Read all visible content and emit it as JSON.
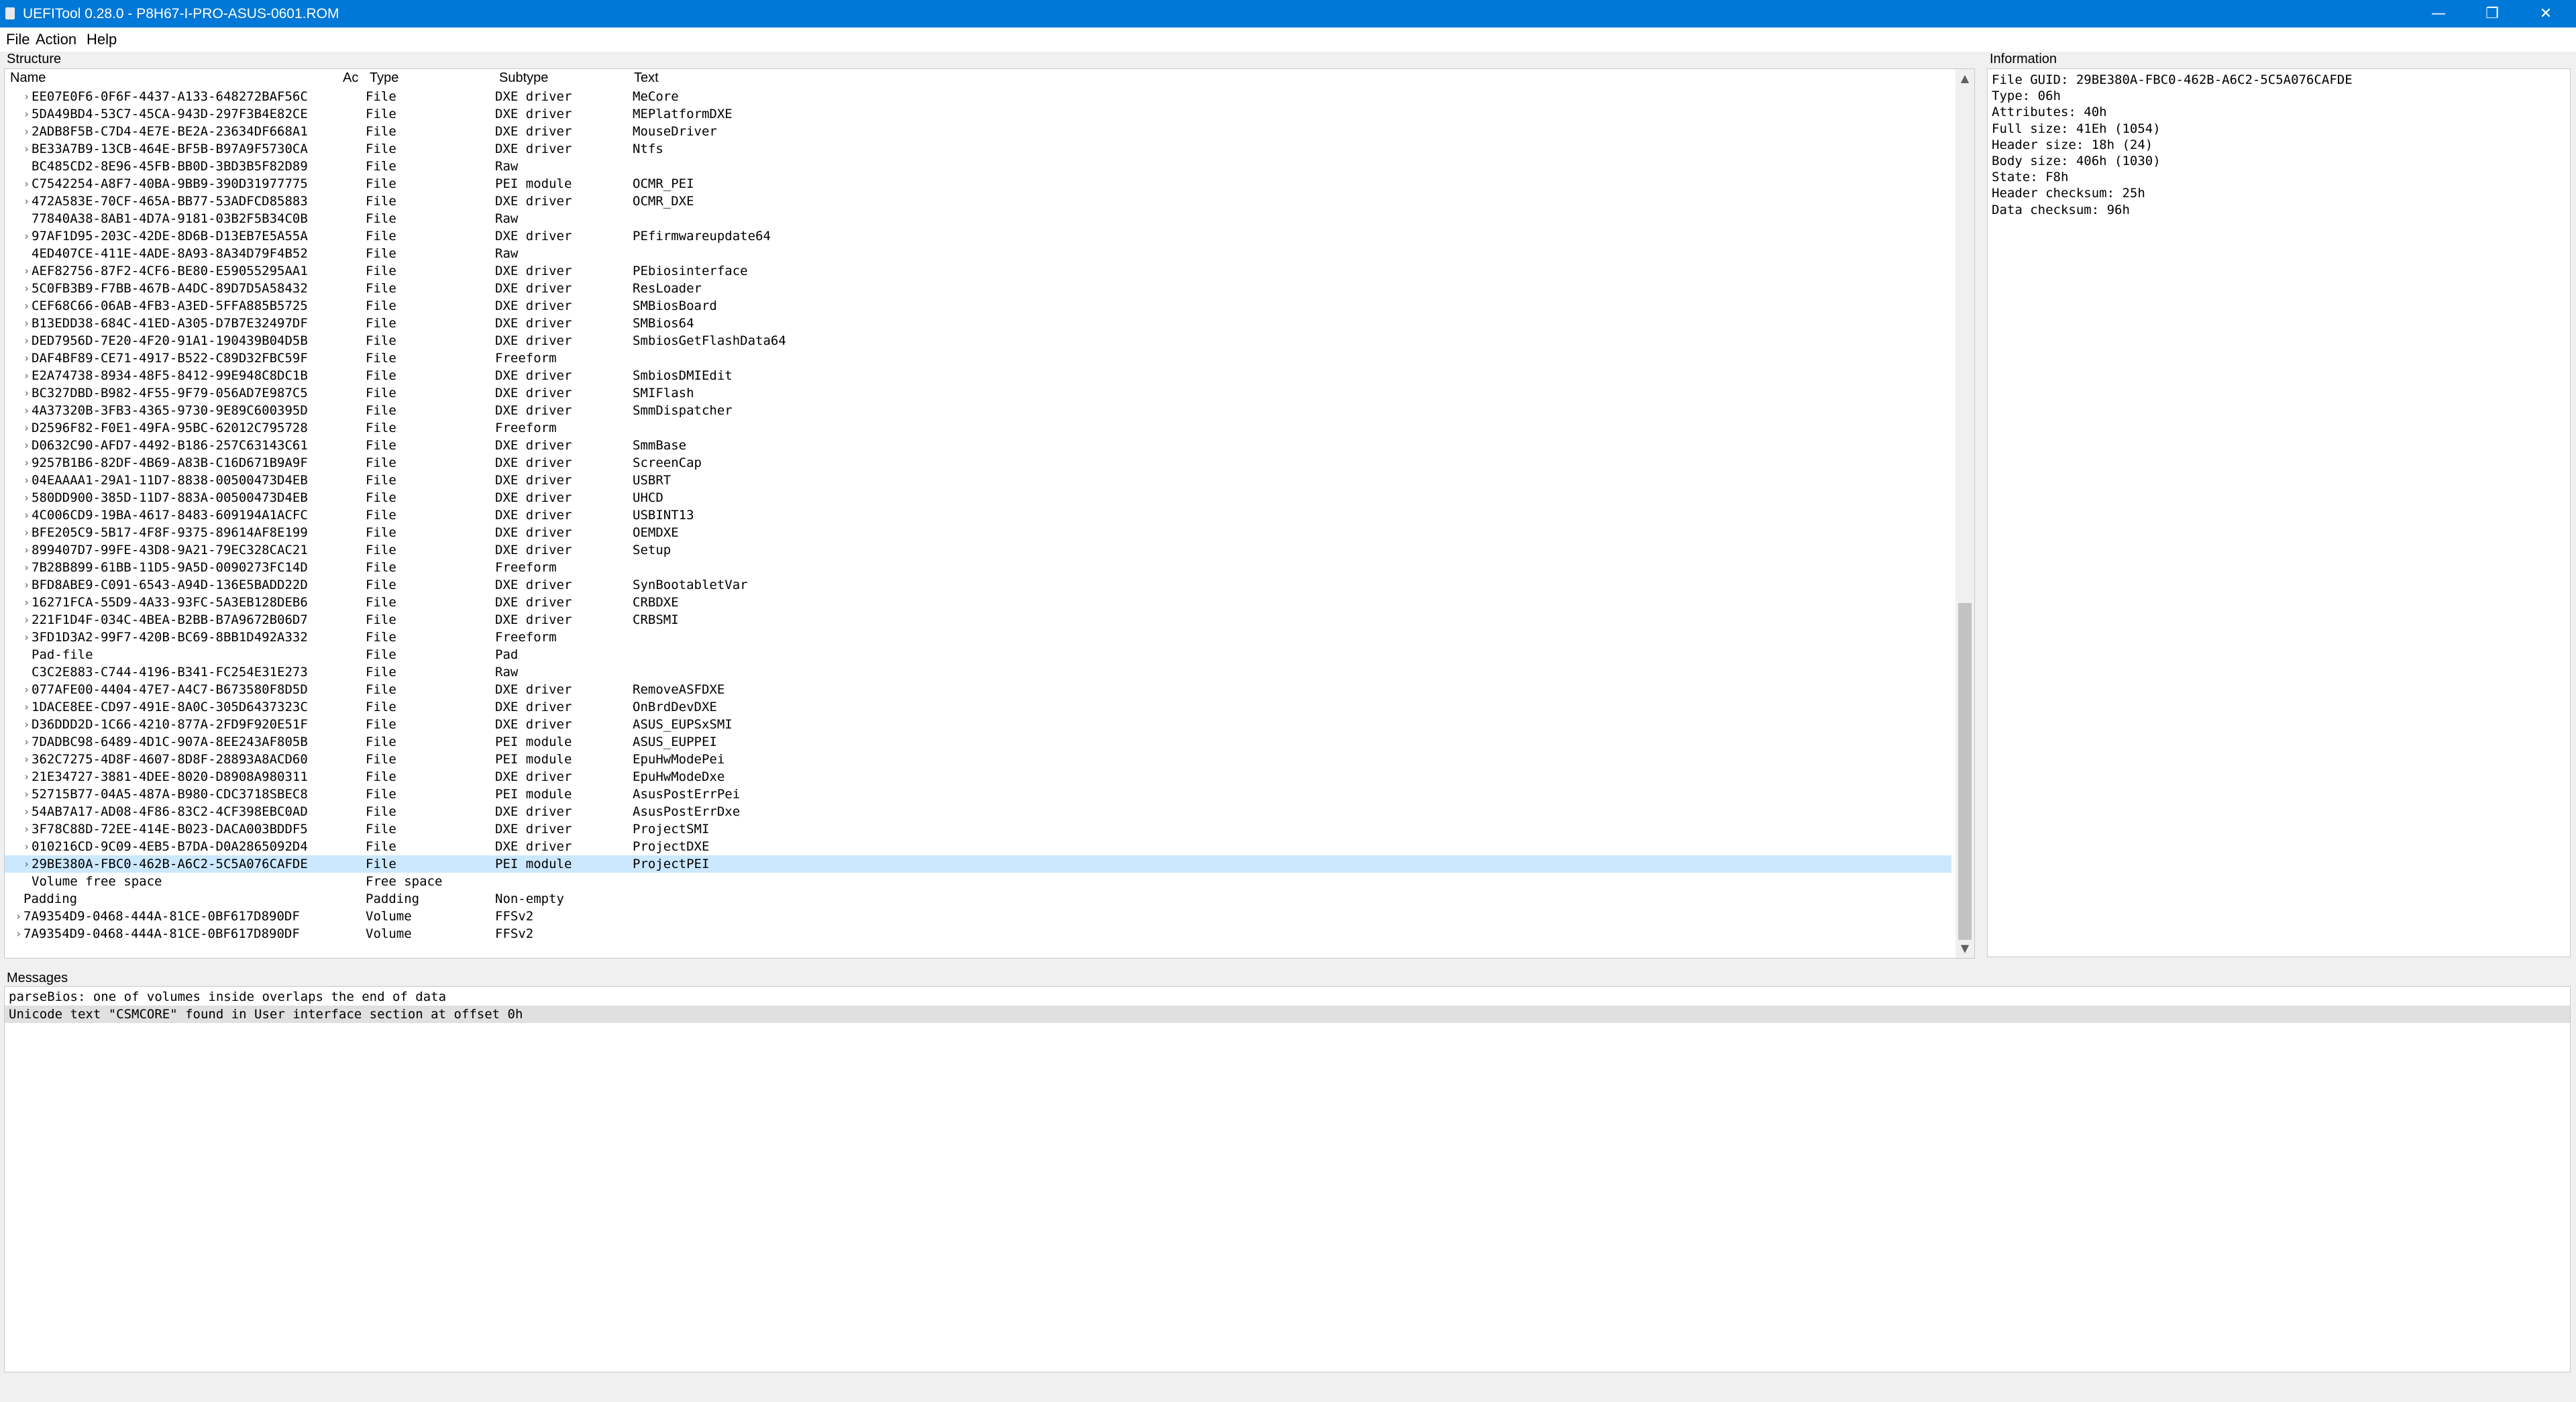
{
  "window": {
    "title": "UEFITool 0.28.0 - P8H67-I-PRO-ASUS-0601.ROM",
    "minimize_glyph": "—",
    "maximize_glyph": "❐",
    "close_glyph": "✕"
  },
  "menu": [
    "File",
    "Action",
    "Help"
  ],
  "structure": {
    "label": "Structure",
    "columns": [
      "Name",
      "Ac",
      "Type",
      "Subtype",
      "Text"
    ],
    "rows": [
      {
        "name": "EE07E0F6-0F6F-4437-A133-648272BAF56C",
        "type": "File",
        "subtype": "DXE driver",
        "text": "MeCore",
        "expandable": true,
        "indent": 1
      },
      {
        "name": "5DA49BD4-53C7-45CA-943D-297F3B4E82CE",
        "type": "File",
        "subtype": "DXE driver",
        "text": "MEPlatformDXE",
        "expandable": true,
        "indent": 1
      },
      {
        "name": "2ADB8F5B-C7D4-4E7E-BE2A-23634DF668A1",
        "type": "File",
        "subtype": "DXE driver",
        "text": "MouseDriver",
        "expandable": true,
        "indent": 1
      },
      {
        "name": "BE33A7B9-13CB-464E-BF5B-B97A9F5730CA",
        "type": "File",
        "subtype": "DXE driver",
        "text": "Ntfs",
        "expandable": true,
        "indent": 1
      },
      {
        "name": "BC485CD2-8E96-45FB-BB0D-3BD3B5F82D89",
        "type": "File",
        "subtype": "Raw",
        "text": "",
        "expandable": false,
        "indent": 1
      },
      {
        "name": "C7542254-A8F7-40BA-9BB9-390D31977775",
        "type": "File",
        "subtype": "PEI module",
        "text": "OCMR_PEI",
        "expandable": true,
        "indent": 1
      },
      {
        "name": "472A583E-70CF-465A-BB77-53ADFCD85883",
        "type": "File",
        "subtype": "DXE driver",
        "text": "OCMR_DXE",
        "expandable": true,
        "indent": 1
      },
      {
        "name": "77840A38-8AB1-4D7A-9181-03B2F5B34C0B",
        "type": "File",
        "subtype": "Raw",
        "text": "",
        "expandable": false,
        "indent": 1
      },
      {
        "name": "97AF1D95-203C-42DE-8D6B-D13EB7E5A55A",
        "type": "File",
        "subtype": "DXE driver",
        "text": "PEfirmwareupdate64",
        "expandable": true,
        "indent": 1
      },
      {
        "name": "4ED407CE-411E-4ADE-8A93-8A34D79F4B52",
        "type": "File",
        "subtype": "Raw",
        "text": "",
        "expandable": false,
        "indent": 1
      },
      {
        "name": "AEF82756-87F2-4CF6-BE80-E59055295AA1",
        "type": "File",
        "subtype": "DXE driver",
        "text": "PEbiosinterface",
        "expandable": true,
        "indent": 1
      },
      {
        "name": "5C0FB3B9-F7BB-467B-A4DC-89D7D5A58432",
        "type": "File",
        "subtype": "DXE driver",
        "text": "ResLoader",
        "expandable": true,
        "indent": 1
      },
      {
        "name": "CEF68C66-06AB-4FB3-A3ED-5FFA885B5725",
        "type": "File",
        "subtype": "DXE driver",
        "text": "SMBiosBoard",
        "expandable": true,
        "indent": 1
      },
      {
        "name": "B13EDD38-684C-41ED-A305-D7B7E32497DF",
        "type": "File",
        "subtype": "DXE driver",
        "text": "SMBios64",
        "expandable": true,
        "indent": 1
      },
      {
        "name": "DED7956D-7E20-4F20-91A1-190439B04D5B",
        "type": "File",
        "subtype": "DXE driver",
        "text": "SmbiosGetFlashData64",
        "expandable": true,
        "indent": 1
      },
      {
        "name": "DAF4BF89-CE71-4917-B522-C89D32FBC59F",
        "type": "File",
        "subtype": "Freeform",
        "text": "",
        "expandable": true,
        "indent": 1
      },
      {
        "name": "E2A74738-8934-48F5-8412-99E948C8DC1B",
        "type": "File",
        "subtype": "DXE driver",
        "text": "SmbiosDMIEdit",
        "expandable": true,
        "indent": 1
      },
      {
        "name": "BC327DBD-B982-4F55-9F79-056AD7E987C5",
        "type": "File",
        "subtype": "DXE driver",
        "text": "SMIFlash",
        "expandable": true,
        "indent": 1
      },
      {
        "name": "4A37320B-3FB3-4365-9730-9E89C600395D",
        "type": "File",
        "subtype": "DXE driver",
        "text": "SmmDispatcher",
        "expandable": true,
        "indent": 1
      },
      {
        "name": "D2596F82-F0E1-49FA-95BC-62012C795728",
        "type": "File",
        "subtype": "Freeform",
        "text": "",
        "expandable": true,
        "indent": 1
      },
      {
        "name": "D0632C90-AFD7-4492-B186-257C63143C61",
        "type": "File",
        "subtype": "DXE driver",
        "text": "SmmBase",
        "expandable": true,
        "indent": 1
      },
      {
        "name": "9257B1B6-82DF-4B69-A83B-C16D671B9A9F",
        "type": "File",
        "subtype": "DXE driver",
        "text": "ScreenCap",
        "expandable": true,
        "indent": 1
      },
      {
        "name": "04EAAAA1-29A1-11D7-8838-00500473D4EB",
        "type": "File",
        "subtype": "DXE driver",
        "text": "USBRT",
        "expandable": true,
        "indent": 1
      },
      {
        "name": "580DD900-385D-11D7-883A-00500473D4EB",
        "type": "File",
        "subtype": "DXE driver",
        "text": "UHCD",
        "expandable": true,
        "indent": 1
      },
      {
        "name": "4C006CD9-19BA-4617-8483-609194A1ACFC",
        "type": "File",
        "subtype": "DXE driver",
        "text": "USBINT13",
        "expandable": true,
        "indent": 1
      },
      {
        "name": "BFE205C9-5B17-4F8F-9375-89614AF8E199",
        "type": "File",
        "subtype": "DXE driver",
        "text": "OEMDXE",
        "expandable": true,
        "indent": 1
      },
      {
        "name": "899407D7-99FE-43D8-9A21-79EC328CAC21",
        "type": "File",
        "subtype": "DXE driver",
        "text": "Setup",
        "expandable": true,
        "indent": 1
      },
      {
        "name": "7B28B899-61BB-11D5-9A5D-0090273FC14D",
        "type": "File",
        "subtype": "Freeform",
        "text": "",
        "expandable": true,
        "indent": 1
      },
      {
        "name": "BFD8ABE9-C091-6543-A94D-136E5BADD22D",
        "type": "File",
        "subtype": "DXE driver",
        "text": "SynBootabletVar",
        "expandable": true,
        "indent": 1
      },
      {
        "name": "16271FCA-55D9-4A33-93FC-5A3EB128DEB6",
        "type": "File",
        "subtype": "DXE driver",
        "text": "CRBDXE",
        "expandable": true,
        "indent": 1
      },
      {
        "name": "221F1D4F-034C-4BEA-B2BB-B7A9672B06D7",
        "type": "File",
        "subtype": "DXE driver",
        "text": "CRBSMI",
        "expandable": true,
        "indent": 1
      },
      {
        "name": "3FD1D3A2-99F7-420B-BC69-8BB1D492A332",
        "type": "File",
        "subtype": "Freeform",
        "text": "",
        "expandable": true,
        "indent": 1
      },
      {
        "name": "Pad-file",
        "type": "File",
        "subtype": "Pad",
        "text": "",
        "expandable": false,
        "indent": 1
      },
      {
        "name": "C3C2E883-C744-4196-B341-FC254E31E273",
        "type": "File",
        "subtype": "Raw",
        "text": "",
        "expandable": false,
        "indent": 1
      },
      {
        "name": "077AFE00-4404-47E7-A4C7-B673580F8D5D",
        "type": "File",
        "subtype": "DXE driver",
        "text": "RemoveASFDXE",
        "expandable": true,
        "indent": 1
      },
      {
        "name": "1DACE8EE-CD97-491E-8A0C-305D6437323C",
        "type": "File",
        "subtype": "DXE driver",
        "text": "OnBrdDevDXE",
        "expandable": true,
        "indent": 1
      },
      {
        "name": "D36DDD2D-1C66-4210-877A-2FD9F920E51F",
        "type": "File",
        "subtype": "DXE driver",
        "text": "ASUS_EUPSxSMI",
        "expandable": true,
        "indent": 1
      },
      {
        "name": "7DADBC98-6489-4D1C-907A-8EE243AF805B",
        "type": "File",
        "subtype": "PEI module",
        "text": "ASUS_EUPPEI",
        "expandable": true,
        "indent": 1
      },
      {
        "name": "362C7275-4D8F-4607-8D8F-28893A8ACD60",
        "type": "File",
        "subtype": "PEI module",
        "text": "EpuHwModePei",
        "expandable": true,
        "indent": 1
      },
      {
        "name": "21E34727-3881-4DEE-8020-D8908A980311",
        "type": "File",
        "subtype": "DXE driver",
        "text": "EpuHwModeDxe",
        "expandable": true,
        "indent": 1
      },
      {
        "name": "52715B77-04A5-487A-B980-CDC3718SBEC8",
        "type": "File",
        "subtype": "PEI module",
        "text": "AsusPostErrPei",
        "expandable": true,
        "indent": 1
      },
      {
        "name": "54AB7A17-AD08-4F86-83C2-4CF398EBC0AD",
        "type": "File",
        "subtype": "DXE driver",
        "text": "AsusPostErrDxe",
        "expandable": true,
        "indent": 1
      },
      {
        "name": "3F78C88D-72EE-414E-B023-DACA003BDDF5",
        "type": "File",
        "subtype": "DXE driver",
        "text": "ProjectSMI",
        "expandable": true,
        "indent": 1
      },
      {
        "name": "010216CD-9C09-4EB5-B7DA-D0A2865092D4",
        "type": "File",
        "subtype": "DXE driver",
        "text": "ProjectDXE",
        "expandable": true,
        "indent": 1
      },
      {
        "name": "29BE380A-FBC0-462B-A6C2-5C5A076CAFDE",
        "type": "File",
        "subtype": "PEI module",
        "text": "ProjectPEI",
        "expandable": true,
        "indent": 1,
        "selected": true
      },
      {
        "name": "Volume free space",
        "type": "Free space",
        "subtype": "",
        "text": "",
        "expandable": false,
        "indent": 1
      },
      {
        "name": "Padding",
        "type": "Padding",
        "subtype": "Non-empty",
        "text": "",
        "expandable": false,
        "indent": 0
      },
      {
        "name": "7A9354D9-0468-444A-81CE-0BF617D890DF",
        "type": "Volume",
        "subtype": "FFSv2",
        "text": "",
        "expandable": true,
        "indent": 0
      },
      {
        "name": "7A9354D9-0468-444A-81CE-0BF617D890DF",
        "type": "Volume",
        "subtype": "FFSv2",
        "text": "",
        "expandable": true,
        "indent": 0
      }
    ]
  },
  "information": {
    "label": "Information",
    "lines": [
      "File GUID: 29BE380A-FBC0-462B-A6C2-5C5A076CAFDE",
      "Type: 06h",
      "Attributes: 40h",
      "Full size: 41Eh (1054)",
      "Header size: 18h (24)",
      "Body size: 406h (1030)",
      "State: F8h",
      "Header checksum: 25h",
      "Data checksum: 96h"
    ]
  },
  "messages": {
    "label": "Messages",
    "lines": [
      {
        "text": "parseBios: one of volumes inside overlaps the end of data",
        "selected": false
      },
      {
        "text": "Unicode text \"CSMCORE\" found in User interface section at offset 0h",
        "selected": true
      }
    ]
  }
}
